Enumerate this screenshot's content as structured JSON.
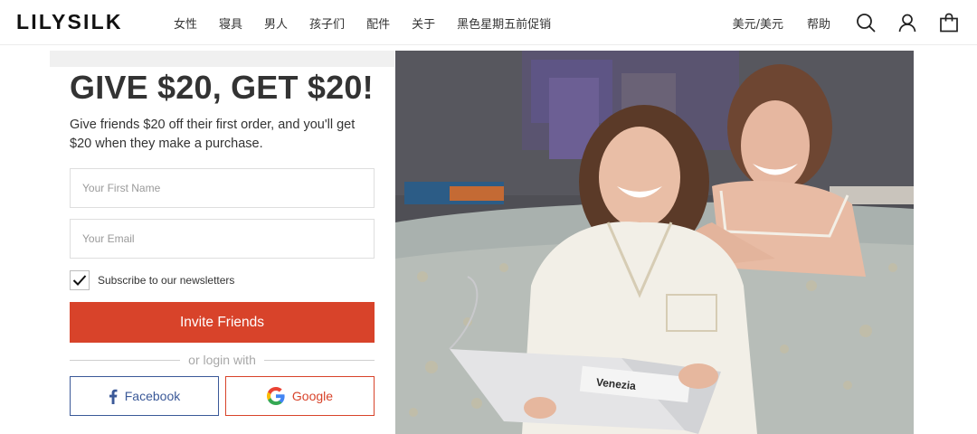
{
  "header": {
    "logo": "LILYSILK",
    "nav": [
      "女性",
      "寝具",
      "男人",
      "孩子们",
      "配件",
      "关于",
      "黑色星期五前促销"
    ],
    "currency": "美元/美元",
    "help": "帮助",
    "icons": [
      "search-icon",
      "account-icon",
      "cart-icon"
    ]
  },
  "promo": {
    "title": "GIVE $20, GET $20!",
    "description": "Give friends $20 off their first order, and you'll get $20 when they make a purchase.",
    "first_name_placeholder": "Your First Name",
    "email_placeholder": "Your Email",
    "subscribe_label": "Subscribe to our newsletters",
    "subscribe_checked": true,
    "invite_label": "Invite Friends",
    "divider_text": "or login with",
    "facebook_label": "Facebook",
    "google_label": "Google"
  },
  "photo": {
    "magazine_text": "Venezia"
  },
  "colors": {
    "accent": "#d8432a",
    "facebook": "#3b5998",
    "text": "#333333"
  }
}
